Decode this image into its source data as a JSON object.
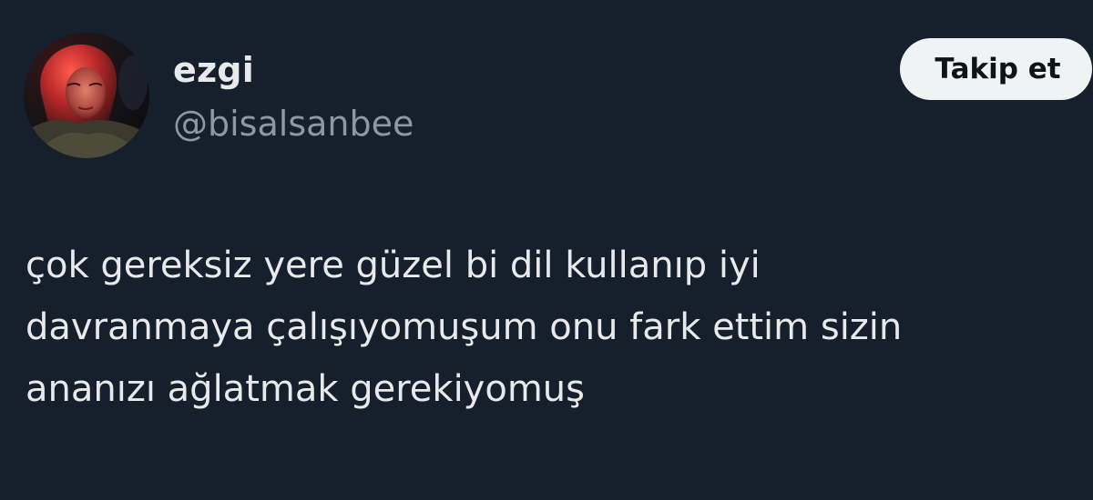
{
  "user": {
    "display_name": "ezgi",
    "handle": "@bisalsanbee"
  },
  "follow_button": {
    "label": "Takip et"
  },
  "tweet": {
    "lines": [
      "çok gereksiz yere güzel bi dil kullanıp iyi",
      "davranmaya çalışıyomuşum onu fark ettim sizin",
      "ananızı ağlatmak gerekiyomuş"
    ]
  },
  "colors": {
    "background": "#16202c",
    "text_primary": "#e7e9ea",
    "text_secondary": "#8b98a5",
    "button_bg": "#eff3f4",
    "button_text": "#0f1419"
  }
}
